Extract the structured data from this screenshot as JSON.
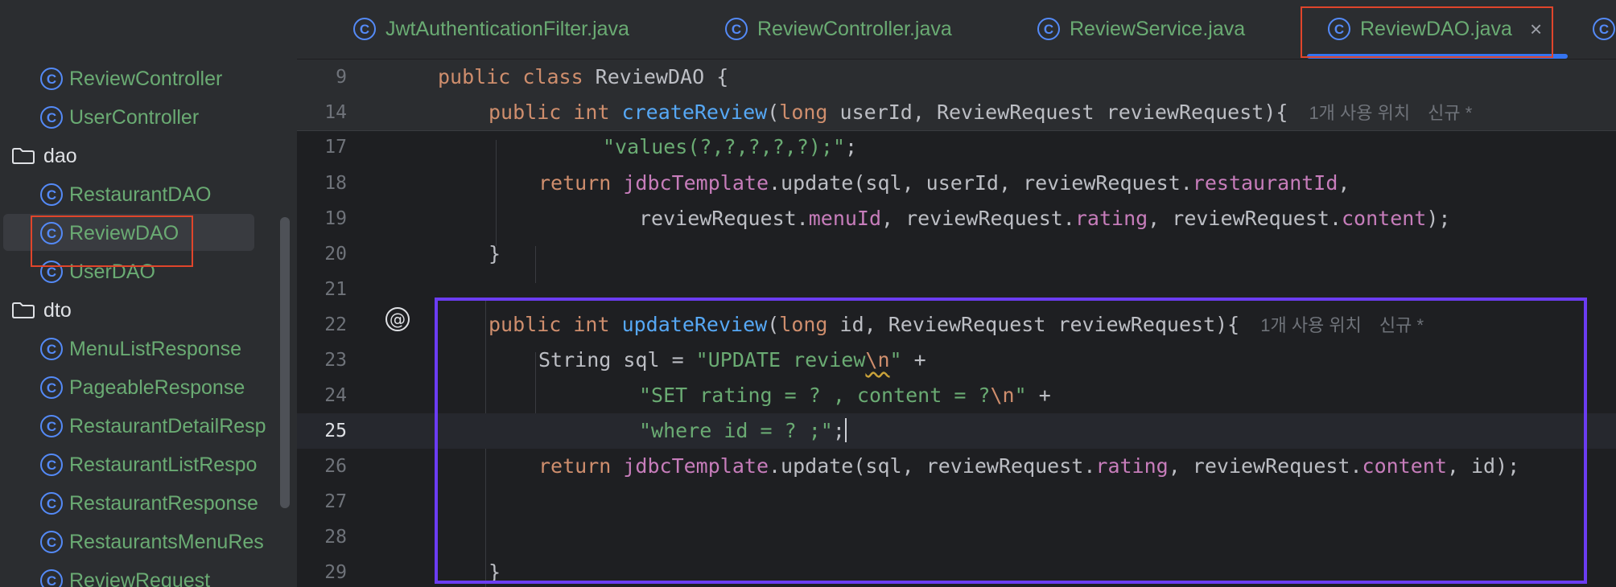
{
  "tabs": [
    {
      "label": "JwtAuthenticationFilter.java",
      "icon": "class-icon"
    },
    {
      "label": "ReviewController.java",
      "icon": "class-icon"
    },
    {
      "label": "ReviewService.java",
      "icon": "class-icon"
    },
    {
      "label": "ReviewDAO.java",
      "icon": "class-icon",
      "active": true,
      "close": "×"
    }
  ],
  "tree": [
    {
      "label": "ReviewController",
      "kind": "class"
    },
    {
      "label": "UserController",
      "kind": "class"
    },
    {
      "label": "dao",
      "kind": "folder"
    },
    {
      "label": "RestaurantDAO",
      "kind": "class"
    },
    {
      "label": "ReviewDAO",
      "kind": "class",
      "selected": true
    },
    {
      "label": "UserDAO",
      "kind": "class"
    },
    {
      "label": "dto",
      "kind": "folder"
    },
    {
      "label": "MenuListResponse",
      "kind": "class"
    },
    {
      "label": "PageableResponse",
      "kind": "class"
    },
    {
      "label": "RestaurantDetailResp",
      "kind": "class"
    },
    {
      "label": "RestaurantListRespo",
      "kind": "class"
    },
    {
      "label": "RestaurantResponse",
      "kind": "class"
    },
    {
      "label": "RestaurantsMenuRes",
      "kind": "class"
    },
    {
      "label": "ReviewRequest",
      "kind": "class"
    }
  ],
  "class_glyph": "C",
  "editor": {
    "line_numbers": [
      "9",
      "14",
      "17",
      "18",
      "19",
      "20",
      "21",
      "22",
      "23",
      "24",
      "25",
      "26",
      "27",
      "28",
      "29"
    ],
    "current_line": "25",
    "gutter_marker": "@",
    "hints": {
      "usages": "1개 사용 위치",
      "new": "신규 *"
    }
  },
  "colors": {
    "keyword": "#cf8e6d",
    "function": "#56a8f5",
    "field": "#c77dbb",
    "string": "#6aab73",
    "annotation_red": "#e0452b",
    "annotation_purple": "#6b3cf2"
  }
}
